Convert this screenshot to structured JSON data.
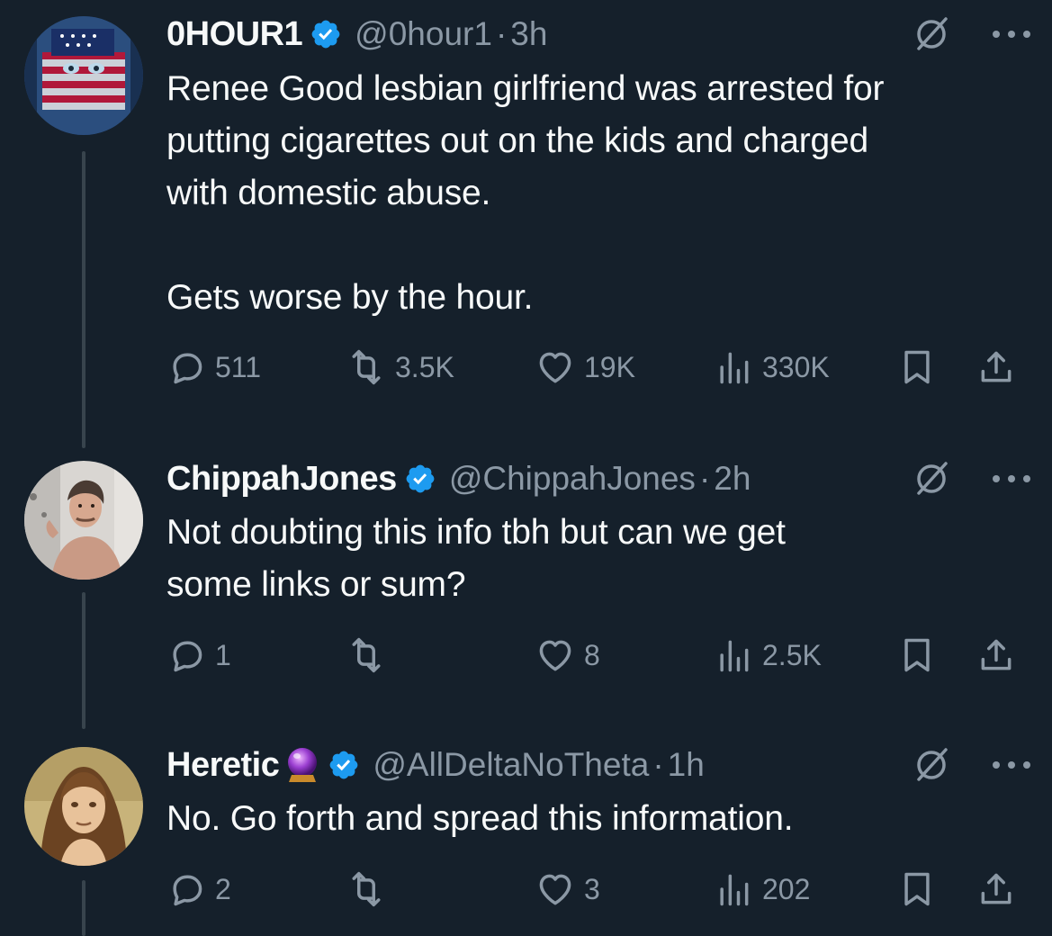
{
  "icons": {
    "reply": "speech-bubble",
    "retweet": "arrows-loop",
    "like": "heart",
    "views": "bar-chart",
    "bookmark": "bookmark",
    "share": "share-up",
    "grok": "slashed-circle",
    "more": "three-dots",
    "verified": "blue-check-badge"
  },
  "colors": {
    "background": "#15202b",
    "text": "#f7f9f9",
    "muted": "#8b98a5",
    "verified_blue": "#1d9bf0"
  },
  "tweets": [
    {
      "name": "0HOUR1",
      "handle": "@0hour1",
      "separator": "·",
      "time": "3h",
      "text": "Renee Good lesbian girlfriend was arrested for\nputting cigarettes out on the kids and charged\nwith domestic abuse.\n\nGets worse by the hour.",
      "replies": "511",
      "retweets": "3.5K",
      "likes": "19K",
      "views": "330K"
    },
    {
      "name": "ChippahJones",
      "handle": "@ChippahJones",
      "separator": "·",
      "time": "2h",
      "text": "Not doubting this info tbh but can we get\nsome links or sum?",
      "replies": "1",
      "retweets": "",
      "likes": "8",
      "views": "2.5K"
    },
    {
      "name": "Heretic",
      "emoji": "crystal-ball",
      "handle": "@AllDeltaNoTheta",
      "separator": "·",
      "time": "1h",
      "text": "No. Go forth and spread this information.",
      "replies": "2",
      "retweets": "",
      "likes": "3",
      "views": "202"
    }
  ]
}
